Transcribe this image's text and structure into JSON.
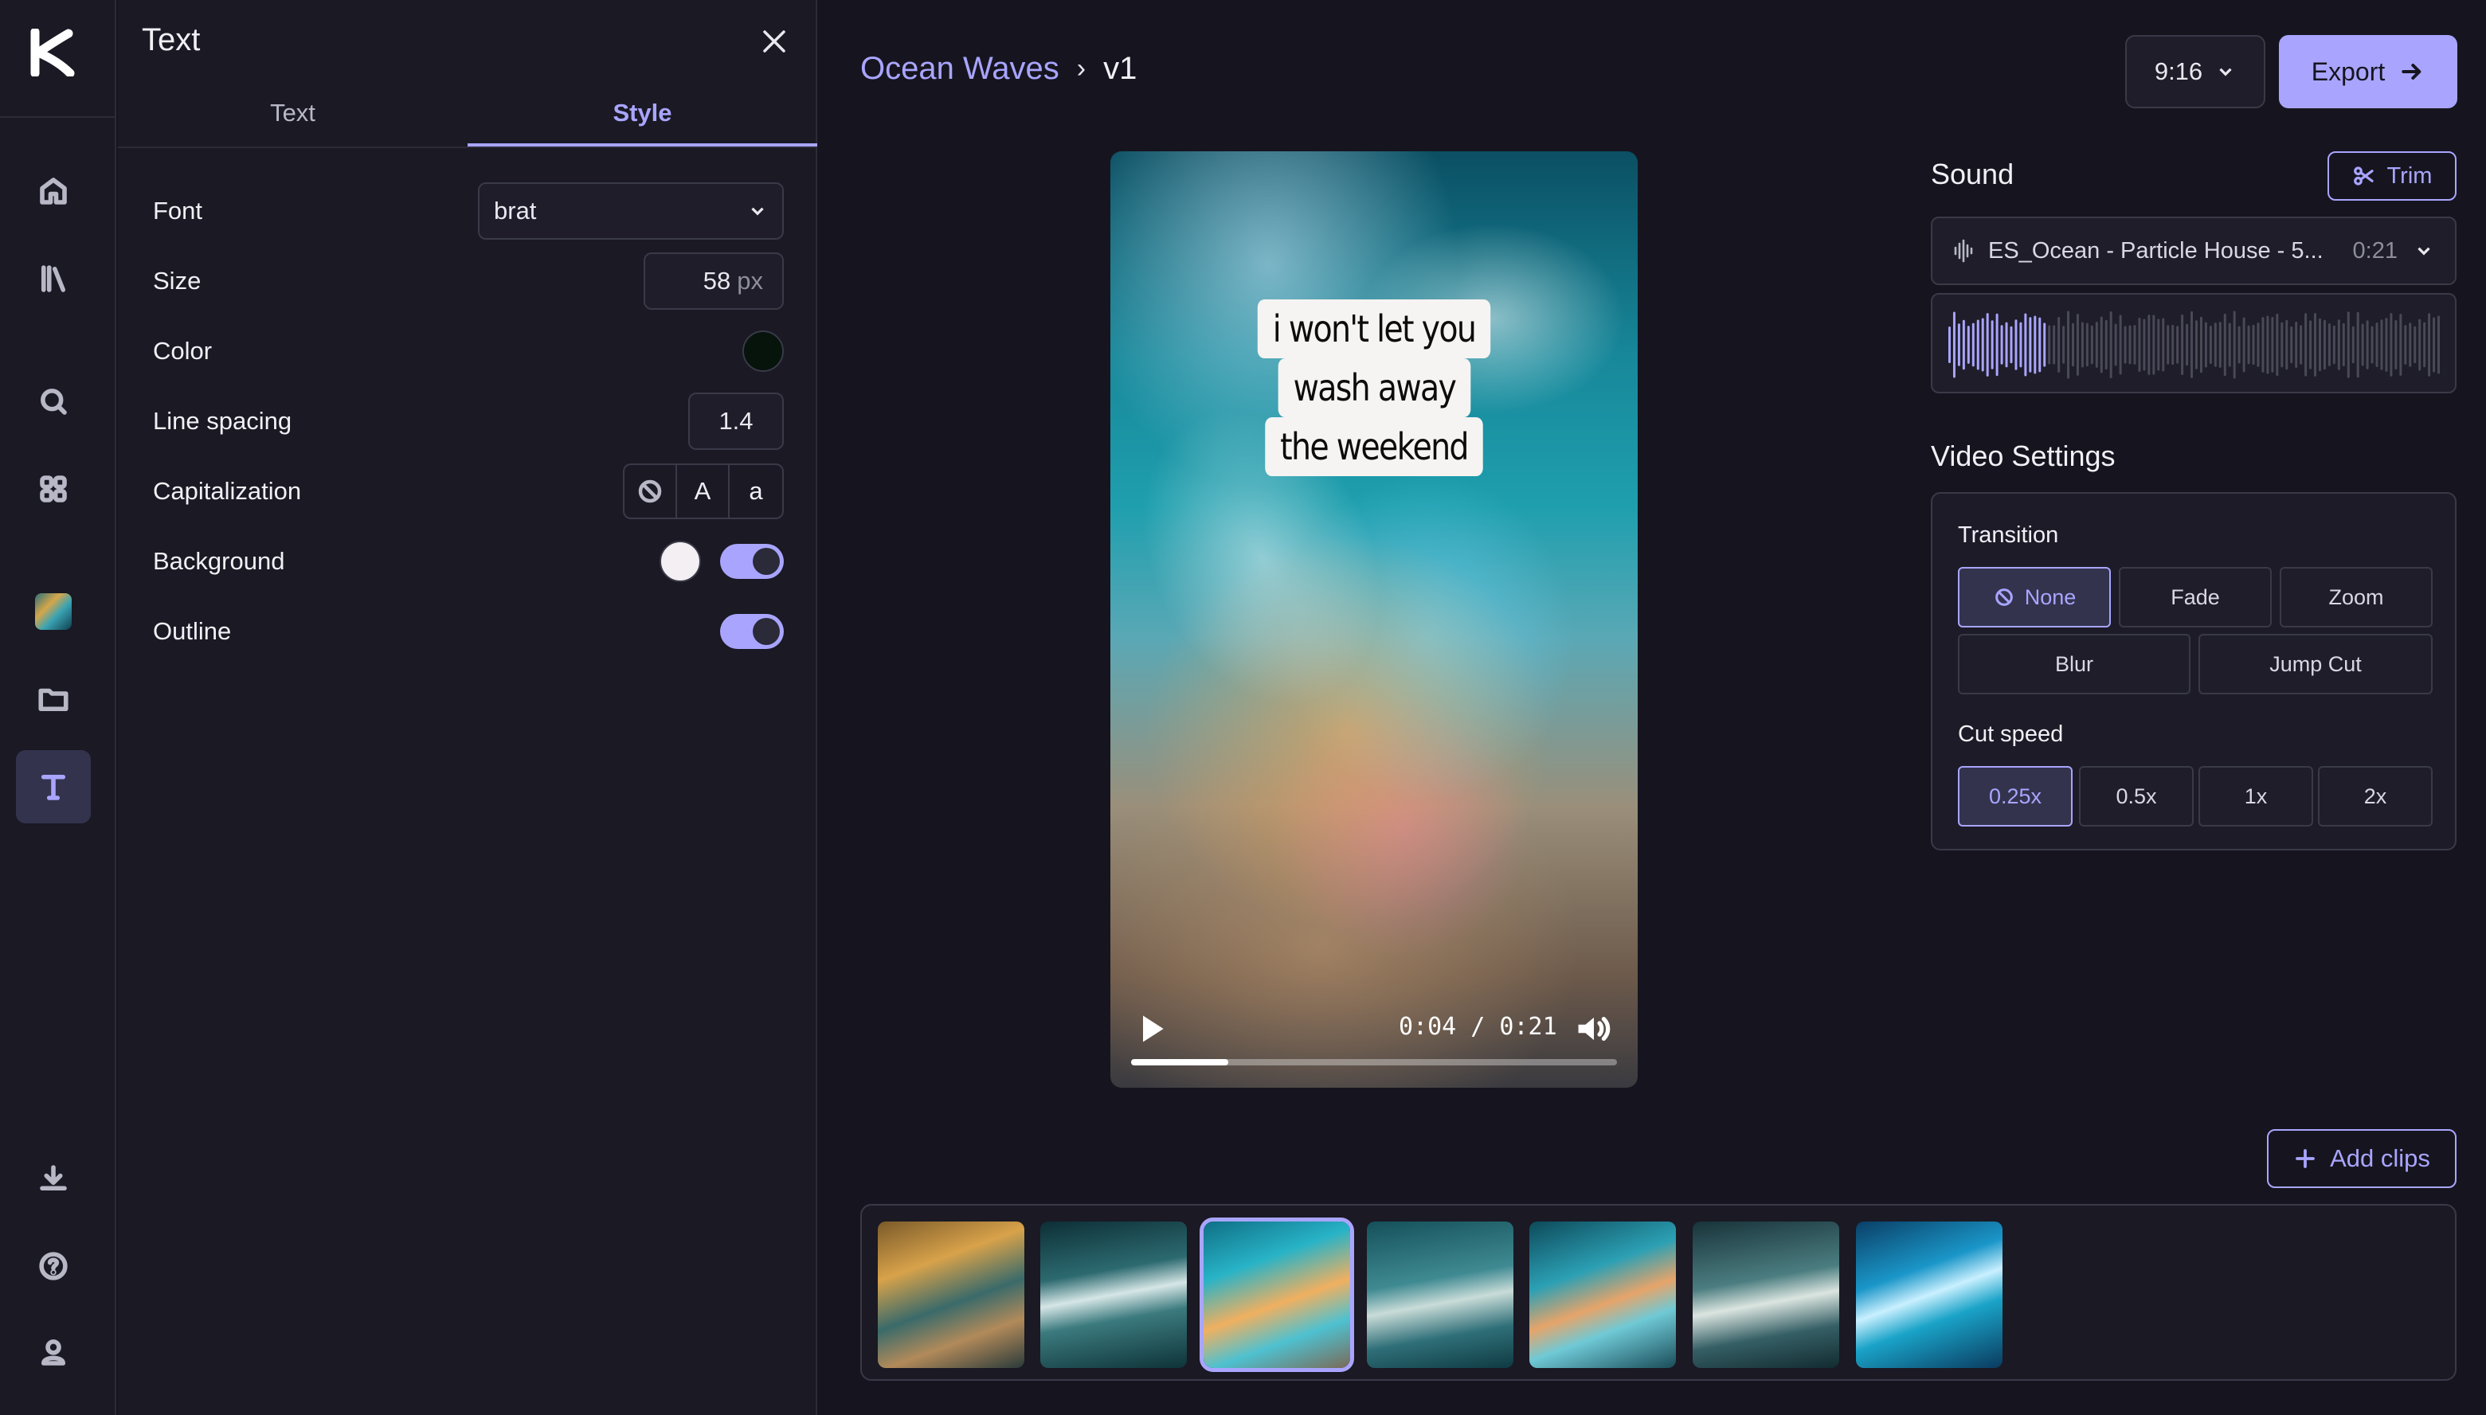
{
  "rail": {
    "items": [
      "home-icon",
      "library-icon",
      "search-icon",
      "apps-grid-icon",
      "media-thumbnail",
      "folder-icon",
      "text-icon",
      "download-icon",
      "help-icon",
      "user-icon"
    ]
  },
  "panel": {
    "title": "Text",
    "tabs": [
      {
        "label": "Text",
        "active": false
      },
      {
        "label": "Style",
        "active": true
      }
    ],
    "font": {
      "label": "Font",
      "value": "brat"
    },
    "size": {
      "label": "Size",
      "value": "58",
      "unit": "px"
    },
    "color": {
      "label": "Color",
      "value": "#06140c"
    },
    "line_spacing": {
      "label": "Line spacing",
      "value": "1.4"
    },
    "capitalization": {
      "label": "Capitalization",
      "options": [
        "none-icon",
        "A",
        "a"
      ]
    },
    "background": {
      "label": "Background",
      "color": "#f3eff2",
      "enabled": true
    },
    "outline": {
      "label": "Outline",
      "enabled": true
    }
  },
  "header": {
    "project": "Ocean Waves",
    "separator": "›",
    "version": "v1",
    "aspect_ratio": "9:16",
    "export_label": "Export"
  },
  "preview": {
    "caption_lines": [
      "i won't let you",
      "wash away",
      "the weekend"
    ],
    "time": "0:04 / 0:21",
    "progress": 0.2
  },
  "sound": {
    "title": "Sound",
    "trim_label": "Trim",
    "track_name": "ES_Ocean - Particle House - 5...",
    "duration": "0:21",
    "played_fraction": 0.2
  },
  "video_settings": {
    "title": "Video Settings",
    "transition_label": "Transition",
    "transitions": [
      {
        "label": "None",
        "selected": true
      },
      {
        "label": "Fade",
        "selected": false
      },
      {
        "label": "Zoom",
        "selected": false
      },
      {
        "label": "Blur",
        "selected": false
      },
      {
        "label": "Jump Cut",
        "selected": false
      }
    ],
    "cut_speed_label": "Cut speed",
    "cut_speeds": [
      {
        "label": "0.25x",
        "selected": true
      },
      {
        "label": "0.5x",
        "selected": false
      },
      {
        "label": "1x",
        "selected": false
      },
      {
        "label": "2x",
        "selected": false
      }
    ]
  },
  "clips": {
    "add_label": "Add clips",
    "selected_index": 2,
    "count": 7
  },
  "colors": {
    "accent": "#a9a5ff",
    "background": "#16151f",
    "panel": "#1a1924"
  }
}
